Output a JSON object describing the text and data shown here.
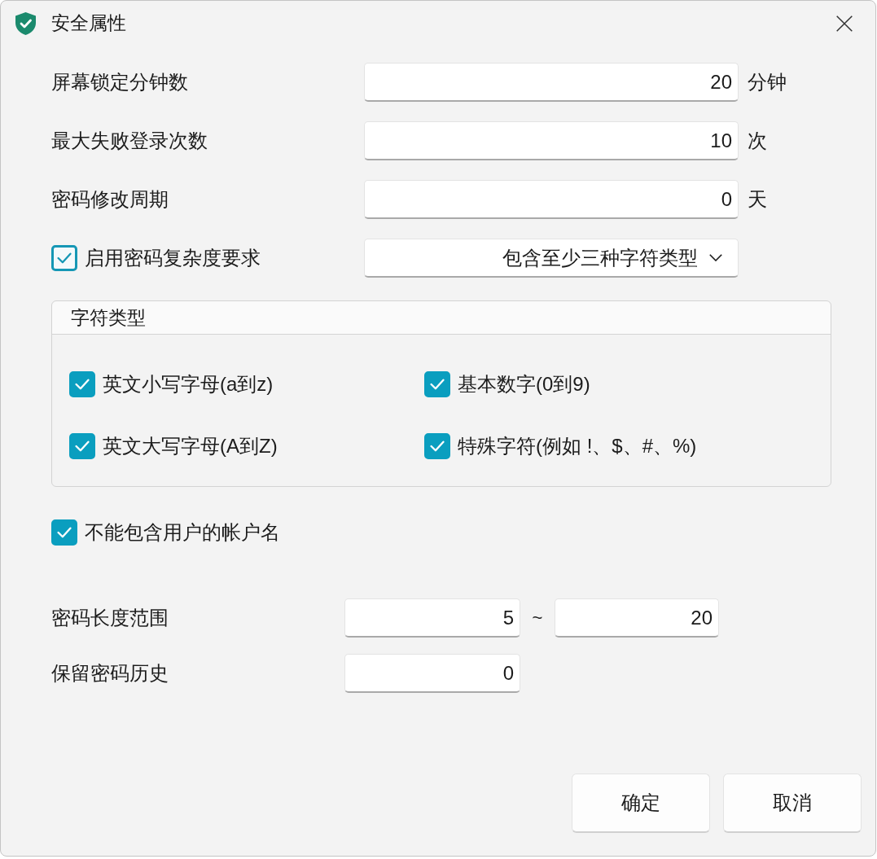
{
  "window": {
    "title": "安全属性"
  },
  "fields": [
    {
      "label": "屏幕锁定分钟数",
      "value": "20",
      "unit": "分钟"
    },
    {
      "label": "最大失败登录次数",
      "value": "10",
      "unit": "次"
    },
    {
      "label": "密码修改周期",
      "value": "0",
      "unit": "天"
    }
  ],
  "complexity": {
    "checkbox": {
      "label": "启用密码复杂度要求",
      "checked": true,
      "focused": true
    },
    "dropdown": {
      "value": "包含至少三种字符类型"
    }
  },
  "character_types": {
    "title": "字符类型",
    "options": [
      {
        "label": "英文小写字母(a到z)",
        "checked": true
      },
      {
        "label": "基本数字(0到9)",
        "checked": true
      },
      {
        "label": "英文大写字母(A到Z)",
        "checked": true
      },
      {
        "label": "特殊字符(例如 !、$、#、%)",
        "checked": true
      }
    ]
  },
  "exclude_username": {
    "label": "不能包含用户的帐户名",
    "checked": true
  },
  "length_range": {
    "label": "密码长度范围",
    "min": "5",
    "separator": "~",
    "max": "20"
  },
  "history": {
    "label": "保留密码历史",
    "value": "0"
  },
  "buttons": [
    "确定",
    "取消"
  ]
}
